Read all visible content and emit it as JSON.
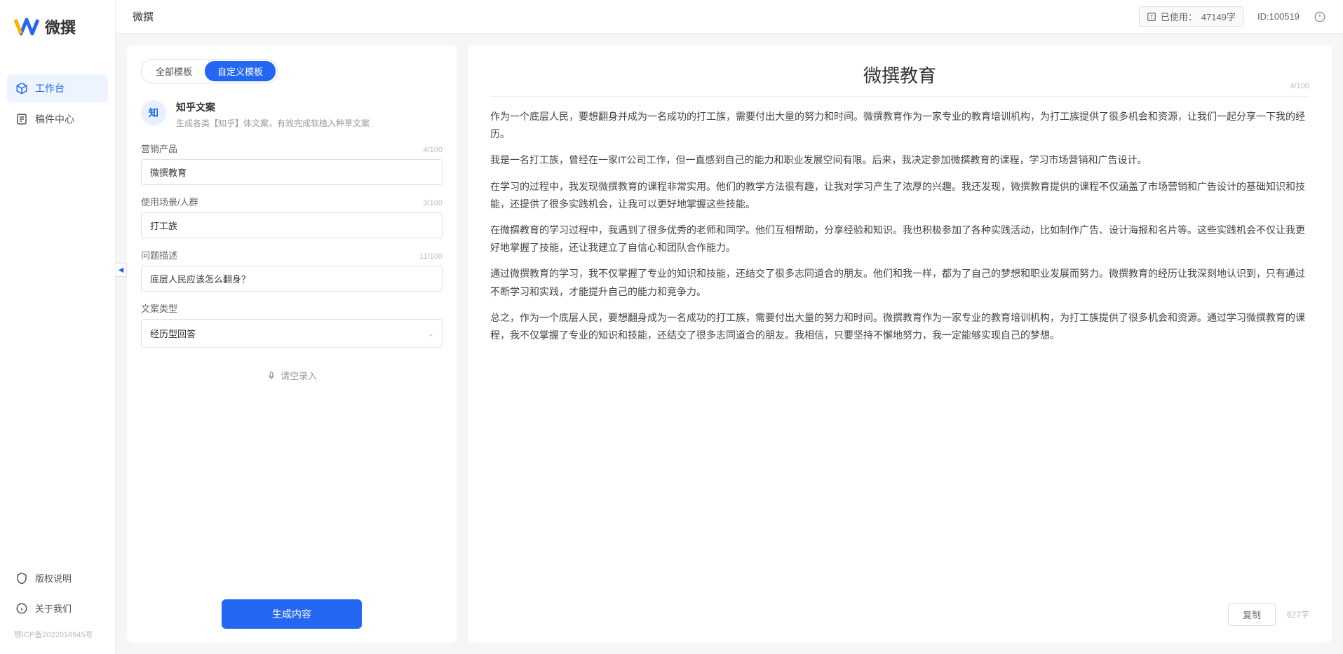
{
  "app": {
    "logo_text": "微撰",
    "page_title": "微撰"
  },
  "sidebar": {
    "nav": [
      {
        "label": "工作台"
      },
      {
        "label": "稿件中心"
      }
    ],
    "bottom": [
      {
        "label": "版权说明"
      },
      {
        "label": "关于我们"
      }
    ],
    "icp": "鄂ICP备2022016945号"
  },
  "topbar": {
    "usage_prefix": "已使用：",
    "usage_value": "47149字",
    "id_label": "ID:100519"
  },
  "tabs": [
    {
      "label": "全部模板"
    },
    {
      "label": "自定义模板"
    }
  ],
  "template": {
    "icon_text": "知",
    "title": "知乎文案",
    "desc": "生成各类【知乎】体文案，有效完成软植入种草文案"
  },
  "form": {
    "product_label": "营销产品",
    "product_value": "微撰教育",
    "product_counter": "4/100",
    "scene_label": "使用场景/人群",
    "scene_value": "打工族",
    "scene_counter": "3/100",
    "problem_label": "问题描述",
    "problem_value": "底层人民应该怎么翻身？",
    "problem_counter": "11/100",
    "type_label": "文案类型",
    "type_value": "经历型回答",
    "speak_label": "请空录入"
  },
  "generate_label": "生成内容",
  "output": {
    "title": "微撰教育",
    "title_counter": "4/100",
    "paragraphs": [
      "作为一个底层人民，要想翻身并成为一名成功的打工族，需要付出大量的努力和时间。微撰教育作为一家专业的教育培训机构，为打工族提供了很多机会和资源，让我们一起分享一下我的经历。",
      "我是一名打工族，曾经在一家IT公司工作，但一直感到自己的能力和职业发展空间有限。后来，我决定参加微撰教育的课程，学习市场营销和广告设计。",
      "在学习的过程中，我发现微撰教育的课程非常实用。他们的教学方法很有趣，让我对学习产生了浓厚的兴趣。我还发现，微撰教育提供的课程不仅涵盖了市场营销和广告设计的基础知识和技能，还提供了很多实践机会，让我可以更好地掌握这些技能。",
      "在微撰教育的学习过程中，我遇到了很多优秀的老师和同学。他们互相帮助，分享经验和知识。我也积极参加了各种实践活动，比如制作广告、设计海报和名片等。这些实践机会不仅让我更好地掌握了技能，还让我建立了自信心和团队合作能力。",
      "通过微撰教育的学习，我不仅掌握了专业的知识和技能，还结交了很多志同道合的朋友。他们和我一样，都为了自己的梦想和职业发展而努力。微撰教育的经历让我深刻地认识到，只有通过不断学习和实践，才能提升自己的能力和竞争力。",
      "总之，作为一个底层人民，要想翻身成为一名成功的打工族，需要付出大量的努力和时间。微撰教育作为一家专业的教育培训机构，为打工族提供了很多机会和资源。通过学习微撰教育的课程，我不仅掌握了专业的知识和技能，还结交了很多志同道合的朋友。我相信，只要坚持不懈地努力，我一定能够实现自己的梦想。"
    ],
    "copy_label": "复制",
    "word_count": "627字"
  }
}
